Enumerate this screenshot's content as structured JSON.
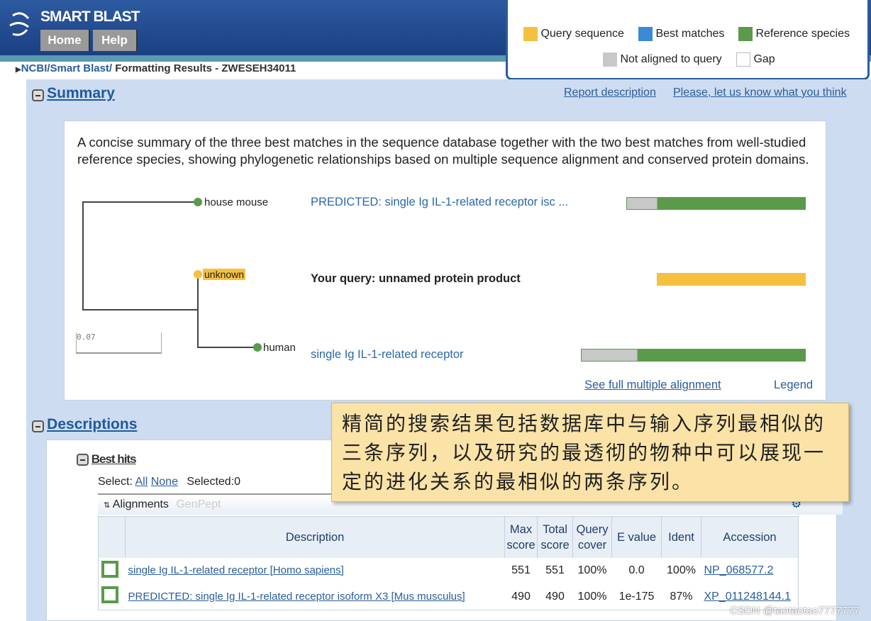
{
  "app": {
    "title": "SMART BLAST",
    "nav": [
      "Home",
      "Help"
    ]
  },
  "breadcrumb": {
    "items": [
      "NCBI/",
      "Smart Blast/"
    ],
    "current": "Formatting Results - ZWESEH34011"
  },
  "legend": {
    "items": [
      {
        "label": "Query sequence",
        "color": "#f5c040"
      },
      {
        "label": "Best matches",
        "color": "#3a8ad8"
      },
      {
        "label": "Reference species",
        "color": "#5a9a4a"
      },
      {
        "label": "Not aligned to query",
        "color": "#c8c8c8"
      },
      {
        "label": "Gap",
        "color": "#ffffff"
      }
    ]
  },
  "summary": {
    "title": "Summary",
    "links": [
      "Report description",
      "Please, let us know what you think"
    ],
    "intro": "A concise summary of the three best matches in the sequence database together with the two best matches from well-studied reference species, showing phylogenetic relationships based on multiple sequence alignment and conserved protein domains.",
    "tree": {
      "nodes": [
        "house mouse",
        "unknown",
        "human"
      ],
      "scale": "0.07"
    },
    "hits": [
      {
        "desc": "PREDICTED: single Ig IL-1-related receptor isc ...",
        "unaligned_pct": 17,
        "type": "reference"
      },
      {
        "desc": "Your query: unnamed protein product",
        "unaligned_pct": 0,
        "type": "query"
      },
      {
        "desc": "single Ig IL-1-related receptor",
        "unaligned_pct": 25,
        "type": "reference"
      }
    ],
    "footer_links": [
      "See full multiple alignment",
      "Legend"
    ]
  },
  "descriptions": {
    "title": "Descriptions",
    "best_hits": "Best hits",
    "select": {
      "label": "Select:",
      "all": "All",
      "none": "None",
      "selected": "Selected:0"
    },
    "tabs": [
      "Alignments",
      "GenPept"
    ],
    "columns": [
      "Description",
      "Max score",
      "Total score",
      "Query cover",
      "E value",
      "Ident",
      "Accession"
    ],
    "rows": [
      [
        "single Ig IL-1-related receptor [Homo sapiens]",
        "551",
        "551",
        "100%",
        "0.0",
        "100%",
        "NP_068577.2"
      ],
      [
        "PREDICTED: single Ig IL-1-related receptor isoform X3 [Mus musculus]",
        "490",
        "490",
        "100%",
        "1e-175",
        "87%",
        "XP_011248144.1"
      ]
    ]
  },
  "tooltip": "精简的搜索结果包括数据库中与输入序列最相似的三条序列，以及研究的最透彻的物种中可以展现一定的进化关系的最相似的两条序列。",
  "watermark": "CSDN @taotaotao7777777"
}
